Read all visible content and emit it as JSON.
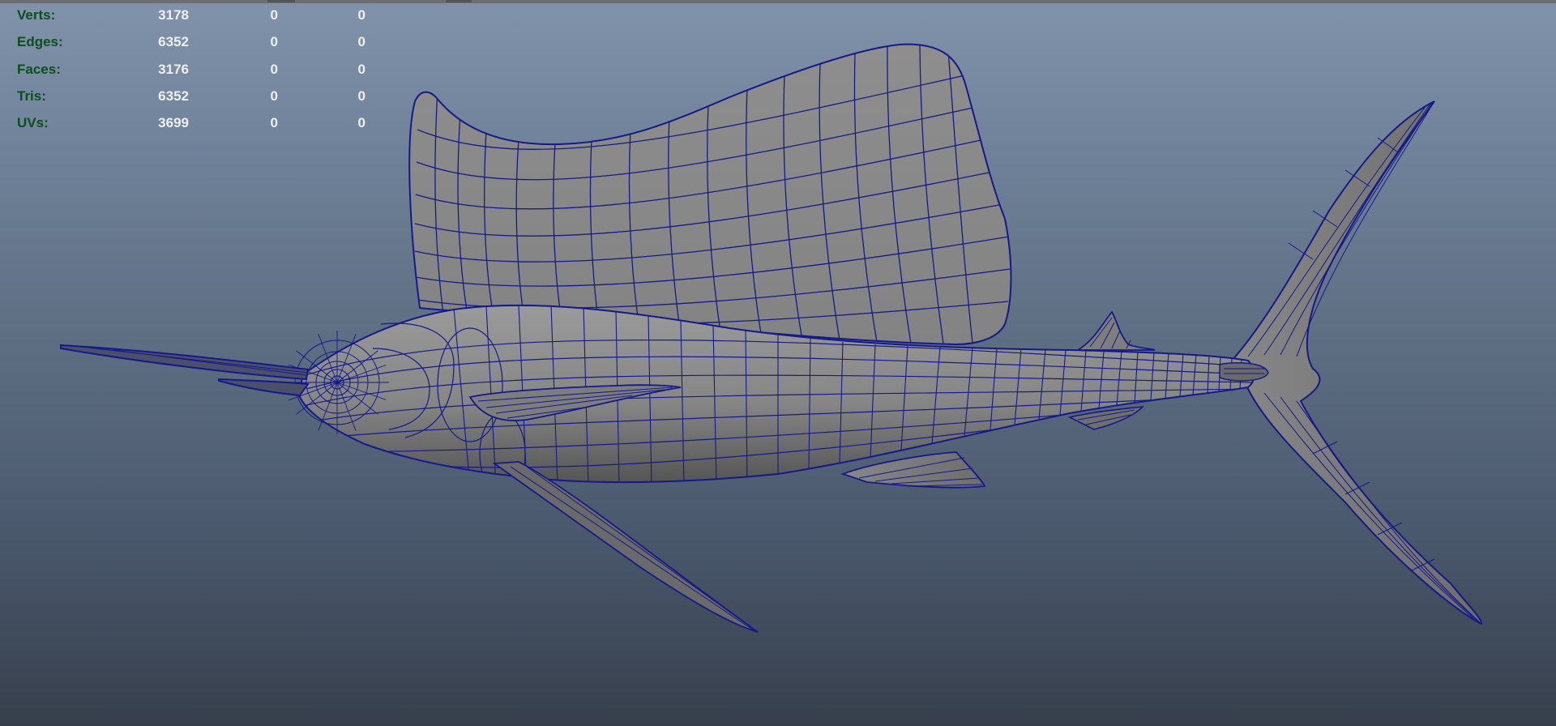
{
  "viewport": {
    "background_top": "#8193ab",
    "background_bottom": "#373f4c",
    "wire_color": "#141a8a",
    "surface_color": "#8a8a8a",
    "subject": "sailfish-polygon-mesh"
  },
  "hud": {
    "rows": [
      {
        "label": "Verts:",
        "c1": "3178",
        "c2": "0",
        "c3": "0"
      },
      {
        "label": "Edges:",
        "c1": "6352",
        "c2": "0",
        "c3": "0"
      },
      {
        "label": "Faces:",
        "c1": "3176",
        "c2": "0",
        "c3": "0"
      },
      {
        "label": "Tris:",
        "c1": "6352",
        "c2": "0",
        "c3": "0"
      },
      {
        "label": "UVs:",
        "c1": "3699",
        "c2": "0",
        "c3": "0"
      }
    ]
  }
}
